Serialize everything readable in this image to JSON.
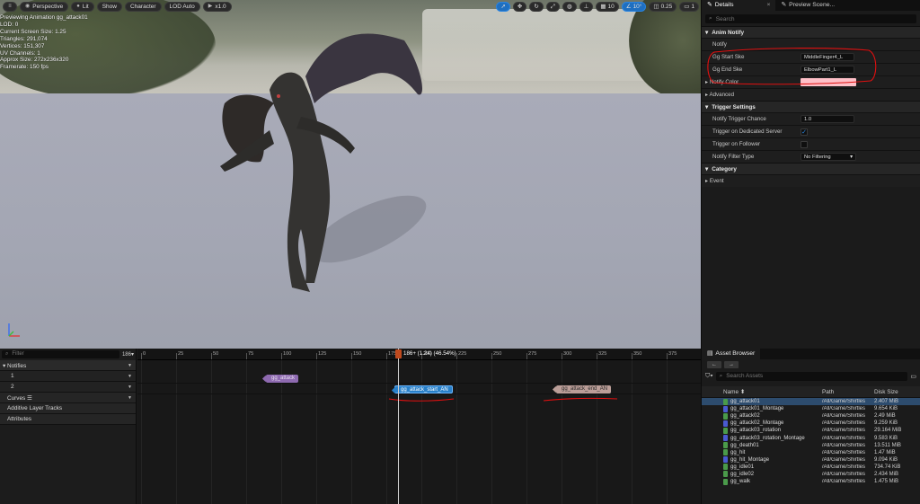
{
  "viewport": {
    "toolbar": [
      {
        "label": "",
        "icon": "menu-icon"
      },
      {
        "label": "Perspective",
        "icon": "perspective-icon"
      },
      {
        "label": "Lit",
        "icon": "lit-icon"
      },
      {
        "label": "Show",
        "icon": ""
      },
      {
        "label": "Character",
        "icon": ""
      },
      {
        "label": "LOD Auto",
        "icon": ""
      },
      {
        "label": "x1.0",
        "icon": "play-icon"
      }
    ],
    "right_toolbar": [
      {
        "label": "",
        "icon": "select-icon"
      },
      {
        "label": "",
        "icon": "move-icon"
      },
      {
        "label": "",
        "icon": "rotate-icon"
      },
      {
        "label": "",
        "icon": "scale-icon"
      },
      {
        "label": "",
        "icon": "world-icon"
      },
      {
        "label": "",
        "icon": "surface-snap-icon"
      },
      {
        "label": "10",
        "icon": "grid-icon"
      },
      {
        "label": "10°",
        "icon": "angle-icon"
      },
      {
        "label": "0.25",
        "icon": "scale-snap-icon"
      },
      {
        "label": "1",
        "icon": "camera-speed-icon"
      }
    ],
    "stats": [
      "Previewing Animation gg_attack01",
      "LOD: 0",
      "Current Screen Size: 1.25",
      "Triangles: 291,074",
      "Vertices: 151,307",
      "UV Channels: 1",
      "Approx Size: 272x236x320",
      "Framerate: 150 fps"
    ]
  },
  "details": {
    "tabs": [
      {
        "label": "Details",
        "icon": "details-icon",
        "close": "×"
      },
      {
        "label": "Preview Scene...",
        "icon": "scene-icon"
      }
    ],
    "search_placeholder": "Search",
    "sections": {
      "anim_notify": "Anim Notify",
      "trigger_settings": "Trigger Settings",
      "category": "Category"
    },
    "notify_label": "Notify",
    "start_label": "Gg Start Ske",
    "start_value": "MiddleFinger4_L",
    "end_label": "Gg End Ske",
    "end_value": "ElbowPart1_L",
    "notify_color_label": "Notify Color",
    "notify_color": "#ffc0c8",
    "advanced_label": "Advanced",
    "trigger_chance_label": "Notify Trigger Chance",
    "trigger_chance_value": "1.0",
    "dedicated_label": "Trigger on Dedicated Server",
    "dedicated_checked": true,
    "follower_label": "Trigger on Follower",
    "follower_checked": false,
    "filter_type_label": "Notify Filter Type",
    "filter_type_value": "No Filtering",
    "event_label": "Event"
  },
  "timeline": {
    "filter_placeholder": "Filter",
    "frame_count": "186",
    "tracks": {
      "notifies": "Notifies",
      "lane1": "1",
      "lane2": "2",
      "curves": "Curves",
      "additive": "Additive Layer Tracks",
      "attributes": "Attributes"
    },
    "ruler_ticks": [
      "0",
      "25",
      "50",
      "75",
      "100",
      "125",
      "150",
      "175",
      "200",
      "225",
      "250",
      "275",
      "300",
      "325",
      "350",
      "375"
    ],
    "playhead_label": "186+ (1.24) (46.54%)",
    "notifies": [
      {
        "label": "gg_attack",
        "lane": 1
      },
      {
        "label": "gg_attack_start_AN",
        "lane": 2
      },
      {
        "label": "gg_attack_end_AN",
        "lane": 2
      }
    ]
  },
  "asset_browser": {
    "tab_label": "Asset Browser",
    "search_placeholder": "Search Assets",
    "columns": {
      "name": "Name",
      "path": "Path",
      "size": "Disk Size"
    },
    "rows": [
      {
        "name": "gg_attack01",
        "path": "/All/Game/Shirtles",
        "size": "2.407 MiB",
        "kind": "anim",
        "selected": true
      },
      {
        "name": "gg_attack01_Montage",
        "path": "/All/Game/Shirtles",
        "size": "9.654 KiB",
        "kind": "montage"
      },
      {
        "name": "gg_attack02",
        "path": "/All/Game/Shirtles",
        "size": "2.49 MiB",
        "kind": "anim"
      },
      {
        "name": "gg_attack02_Montage",
        "path": "/All/Game/Shirtles",
        "size": "9.259 KiB",
        "kind": "montage"
      },
      {
        "name": "gg_attack03_rotation",
        "path": "/All/Game/Shirtles",
        "size": "29.164 MiB",
        "kind": "anim"
      },
      {
        "name": "gg_attack03_rotation_Montage",
        "path": "/All/Game/Shirtles",
        "size": "9.583 KiB",
        "kind": "montage"
      },
      {
        "name": "gg_death01",
        "path": "/All/Game/Shirtles",
        "size": "13.511 MiB",
        "kind": "anim"
      },
      {
        "name": "gg_hit",
        "path": "/All/Game/Shirtles",
        "size": "1.47 MiB",
        "kind": "anim"
      },
      {
        "name": "gg_hit_Montage",
        "path": "/All/Game/Shirtles",
        "size": "9.094 KiB",
        "kind": "montage"
      },
      {
        "name": "gg_idle01",
        "path": "/All/Game/Shirtles",
        "size": "734.74 KiB",
        "kind": "anim"
      },
      {
        "name": "gg_idle02",
        "path": "/All/Game/Shirtles",
        "size": "2.434 MiB",
        "kind": "anim"
      },
      {
        "name": "gg_walk",
        "path": "/All/Game/Shirtles",
        "size": "1.475 MiB",
        "kind": "anim"
      }
    ]
  },
  "colors": {
    "accent": "#1f6fc0",
    "annotation_red": "#e01010"
  }
}
